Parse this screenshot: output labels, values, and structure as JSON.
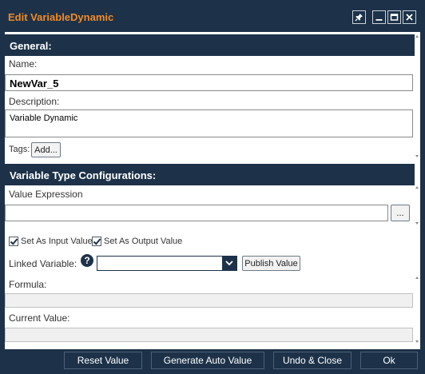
{
  "window": {
    "title": "Edit VariableDynamic",
    "pin_icon": "pin-icon",
    "minimize_icon": "minimize-icon",
    "maximize_icon": "maximize-icon",
    "close_icon": "close-icon"
  },
  "general": {
    "header": "General:",
    "name_label": "Name:",
    "name_value": "NewVar_5",
    "description_label": "Description:",
    "description_value": "Variable Dynamic",
    "tags_label": "Tags:",
    "add_button": "Add..."
  },
  "variable_type": {
    "header": "Variable Type Configurations:",
    "value_expression_label": "Value Expression",
    "value_expression_value": "",
    "browse_button": "...",
    "set_as_input_label": "Set As Input Value",
    "set_as_input_checked": true,
    "set_as_output_label": "Set As Output Value",
    "set_as_output_checked": true,
    "linked_variable_label": "Linked Variable:",
    "linked_variable_value": "",
    "publish_button": "Publish Value",
    "formula_label": "Formula:",
    "formula_value": "",
    "current_value_label": "Current Value:",
    "current_value_value": ""
  },
  "footer": {
    "reset_button": "Reset Value",
    "generate_button": "Generate Auto Value",
    "undo_close_button": "Undo & Close",
    "ok_button": "Ok"
  },
  "colors": {
    "frame": "#1d3249",
    "title_text": "#f08a24",
    "content_bg": "#ffffff"
  }
}
